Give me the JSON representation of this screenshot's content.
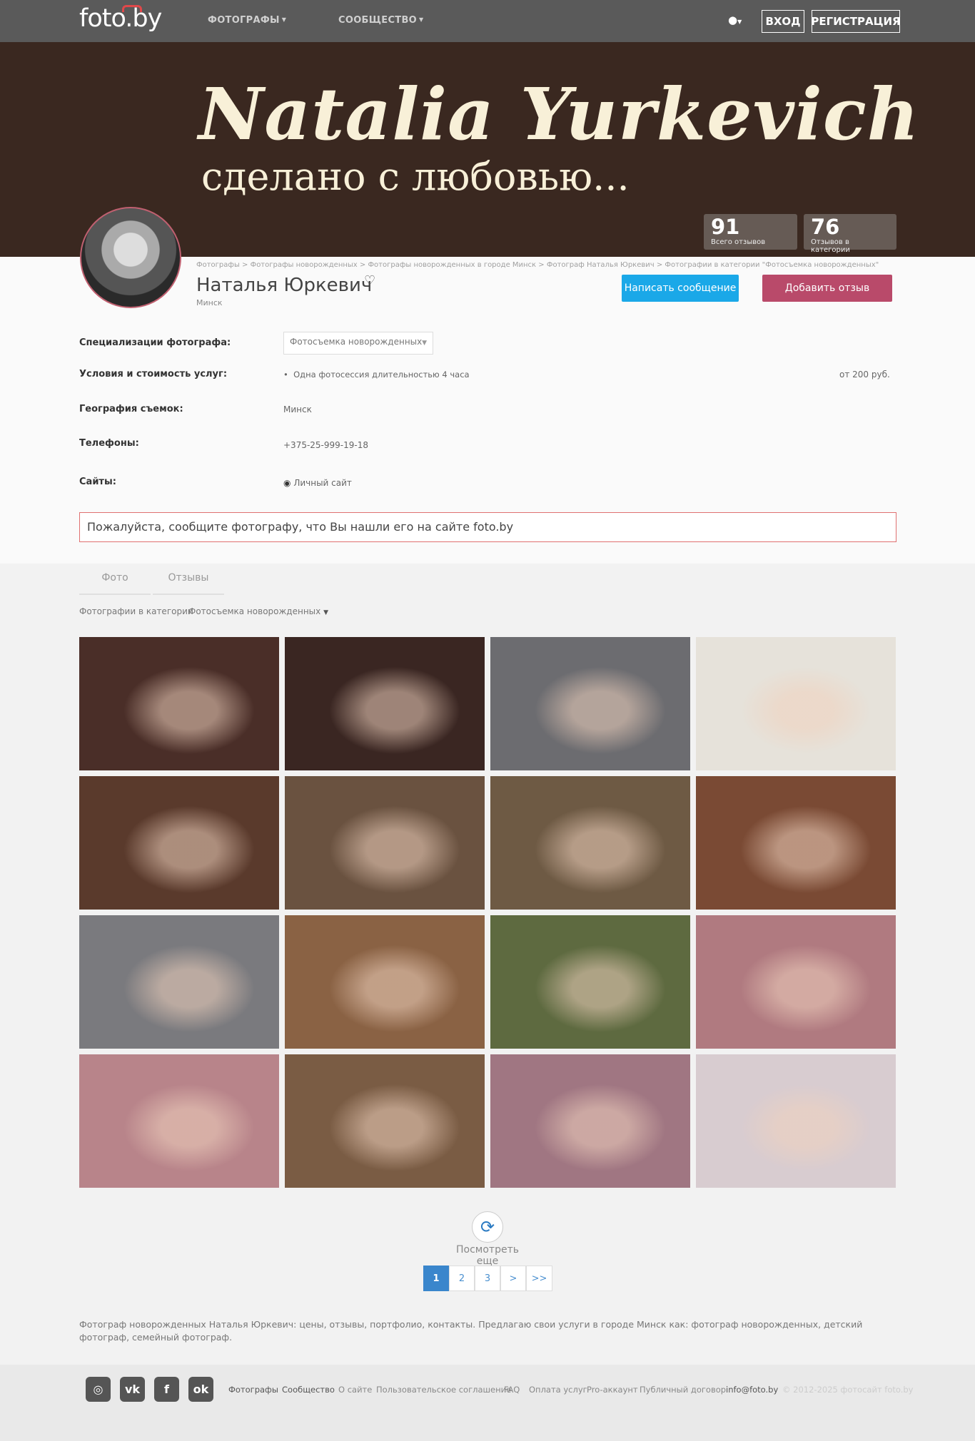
{
  "navbar": {
    "logo": "foto.by",
    "menu": [
      {
        "label": "ФОТОГРАФЫ"
      },
      {
        "label": "СООБЩЕСТВО"
      }
    ],
    "language_icon": "globe-icon",
    "login_label": "ВХОД",
    "register_label": "РЕГИСТРАЦИЯ"
  },
  "cover": {
    "title": "Natalia  Yurkevich",
    "tagline": "сделано с любовью...",
    "stats": [
      {
        "value": "91",
        "label": "Всего отзывов"
      },
      {
        "value": "76",
        "label": "Отзывов в категории"
      }
    ]
  },
  "profile": {
    "breadcrumb": "Фотографы > Фотографы новорожденных > Фотографы новорожденных в городе Минск > Фотограф Наталья Юркевич > Фотографии в категории \"Фотосъемка новорожденных\"",
    "name": "Наталья Юркевич",
    "city": "Минск",
    "message_button": "Написать сообщение",
    "review_button": "Добавить отзыв"
  },
  "info": {
    "specializations_label": "Специализации фотографа:",
    "specialization_value": "Фотосъемка новорожденных",
    "services_label": "Условия и стоимость услуг:",
    "service_item": "Одна фотосессия длительностью 4 часа",
    "service_price": "от 200 руб.",
    "geography_label": "География съемок:",
    "geography_value": "Минск",
    "phones_label": "Телефоны:",
    "phone_value": "+375-25-999-19-18",
    "sites_label": "Сайты:",
    "site_value": "Личный сайт"
  },
  "notice": "Пожалуйста, сообщите фотографу, что Вы нашли его на сайте foto.by",
  "tabs": [
    {
      "label": "Фото"
    },
    {
      "label": "Отзывы"
    }
  ],
  "filter": {
    "label": "Фотографии в категории",
    "value": "Фотосъемка новорожденных"
  },
  "gallery": {
    "colors": [
      "#4a2e28",
      "#3a2622",
      "#6c6c70",
      "#e6e2da",
      "#5a3a2c",
      "#6a5240",
      "#6e5a44",
      "#7a4a34",
      "#7a7a7e",
      "#8a6244",
      "#5e6a40",
      "#b07a80",
      "#b8848a",
      "#7a5c44",
      "#a07682",
      "#d8ccd0"
    ]
  },
  "load_more": "Посмотреть еще",
  "pagination": [
    "1",
    "2",
    "3",
    ">",
    ">>"
  ],
  "seo_text": "Фотограф новорожденных Наталья Юркевич: цены, отзывы, портфолио, контакты. Предлагаю свои услуги в городе Минск как: фотограф новорожденных, детский фотограф, семейный фотограф.",
  "footer": {
    "social": [
      "instagram-icon",
      "vk-icon",
      "facebook-icon",
      "odnoklassniki-icon"
    ],
    "links": [
      "Фотографы",
      "Сообщество",
      "О сайте",
      "Пользовательское соглашение",
      "FAQ",
      "Оплата услуг",
      "Pro-аккаунт",
      "Публичный договор",
      "info@foto.by"
    ],
    "copyright": "© 2012-2025 фотосайт foto.by"
  }
}
